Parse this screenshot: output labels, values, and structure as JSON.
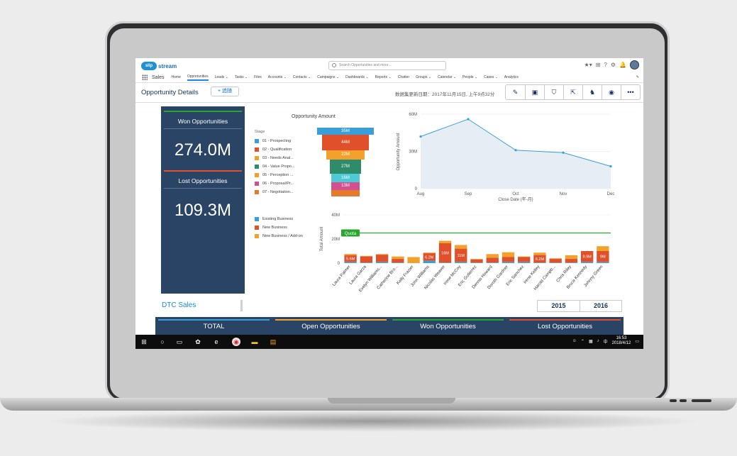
{
  "brand": {
    "logo_text": "stream",
    "logo_prefix": "slip"
  },
  "search": {
    "placeholder": "Search Opportunities and more..."
  },
  "app_name": "Sales",
  "nav": [
    {
      "label": "Home"
    },
    {
      "label": "Opportunities",
      "active": true
    },
    {
      "label": "Leads ⌄"
    },
    {
      "label": "Tasks ⌄"
    },
    {
      "label": "Files"
    },
    {
      "label": "Accounts ⌄"
    },
    {
      "label": "Contacts ⌄"
    },
    {
      "label": "Campaigns ⌄"
    },
    {
      "label": "Dashboards ⌄"
    },
    {
      "label": "Reports ⌄"
    },
    {
      "label": "Chatter"
    },
    {
      "label": "Groups ⌄"
    },
    {
      "label": "Calendar ⌄"
    },
    {
      "label": "People ⌄"
    },
    {
      "label": "Cases ⌄"
    },
    {
      "label": "Analytics"
    }
  ],
  "page": {
    "title": "Opportunity Details",
    "follow_label": "+ 追随",
    "updated": "数据集更新日期：2017年11月15日, 上午9点32分"
  },
  "kpi": {
    "won_label": "Won Opportunities",
    "won_value": "274.0M",
    "lost_label": "Lost Opportunities",
    "lost_value": "109.3M"
  },
  "funnel": {
    "title": "Opportunity Amount",
    "legend_title": "Stage",
    "stages": [
      {
        "label": "01 - Prospecting",
        "color": "#3a9fd8",
        "value": "35M"
      },
      {
        "label": "02 - Qualification",
        "color": "#e0502a",
        "value": "44M"
      },
      {
        "label": "03 - Needs Anal...",
        "color": "#f2a22b",
        "value": "22M"
      },
      {
        "label": "04 - Value Propo...",
        "color": "#2f8c6a",
        "value": "27M"
      },
      {
        "label": "05 - Perception ...",
        "color": "#f2a22b",
        "value": "16M"
      },
      {
        "label": "06 - Proposal/Pr...",
        "color": "#d44f8f",
        "value": "13M"
      },
      {
        "label": "07 - Negotiation...",
        "color": "#e57a2b",
        "value": ""
      }
    ],
    "segments": [
      {
        "value": "35M",
        "color": "#3a9fd8"
      },
      {
        "value": "44M",
        "color": "#e0502a"
      },
      {
        "value": "22M",
        "color": "#f2a22b"
      },
      {
        "value": "27M",
        "color": "#2f8c6a"
      },
      {
        "value": "16M",
        "color": "#4ec9d6"
      },
      {
        "value": "13M",
        "color": "#d44f8f"
      },
      {
        "value": "",
        "color": "#e57a2b"
      }
    ]
  },
  "chart_data": [
    {
      "type": "area",
      "x": [
        "Aug",
        "Sep",
        "Oct",
        "Nov",
        "Dec"
      ],
      "values": [
        42,
        56,
        31,
        29,
        18
      ],
      "xlabel": "Close Date (年-月)",
      "ylabel": "Opportunity Amount",
      "yticks": [
        "60M",
        "30M",
        "0"
      ],
      "ylim": [
        0,
        60
      ],
      "color": "#3a9fd8"
    },
    {
      "type": "bar",
      "categories": [
        "Laura Palmer",
        "Laura Garza",
        "Evelyn Williams...",
        "Catherine Bro...",
        "Kelly Frazier",
        "John Williams",
        "Nicolas Weaver",
        "Irene McCoy",
        "Eric Gutierrez",
        "Dennis Howard",
        "Doroth Gardner",
        "Eric Sanchez",
        "Irene Kelley",
        "Harold Campb...",
        "Chris Riley",
        "Bruce Kennedy",
        "Johnny Green"
      ],
      "series": [
        {
          "name": "Existing Business",
          "color": "#3a9fd8",
          "values": [
            1,
            0.5,
            1,
            0.5,
            0,
            2,
            0.5,
            1,
            0.5,
            0.5,
            1,
            1,
            0.5,
            0.5,
            0.5,
            1,
            1
          ]
        },
        {
          "name": "New Business",
          "color": "#e0502a",
          "values": [
            5.6,
            5,
            6,
            3,
            0,
            6.2,
            16,
            11,
            2.5,
            4,
            4,
            4,
            6.2,
            3,
            3,
            9,
            9
          ]
        },
        {
          "name": "New Business / Add-on",
          "color": "#f2a22b",
          "values": [
            1,
            0.5,
            0.5,
            2,
            5,
            0.5,
            2,
            3,
            0.5,
            3,
            4,
            0.5,
            2,
            0.5,
            3,
            0,
            4
          ]
        }
      ],
      "data_labels": [
        "5.6M",
        "",
        "",
        "",
        "",
        "6.2M",
        "16M",
        "11M",
        "",
        "",
        "",
        "",
        "6.2M",
        "",
        "",
        "9.9M",
        "9M"
      ],
      "ylabel": "Total Amount",
      "yticks": [
        "40M",
        "20M",
        "0"
      ],
      "ylim": [
        0,
        40
      ],
      "quota_label": "Quota",
      "quota_value": 25,
      "quota_color": "#2aa52f"
    }
  ],
  "bar_legend": [
    {
      "label": "Existing Business",
      "color": "#3a9fd8"
    },
    {
      "label": "New Business",
      "color": "#e0502a"
    },
    {
      "label": "New Business / Add-on",
      "color": "#f2a22b"
    }
  ],
  "section": {
    "title": "DTC Sales"
  },
  "years": [
    "2015",
    "2016"
  ],
  "summary": [
    {
      "label": "TOTAL",
      "color": "#3a9fd8"
    },
    {
      "label": "Open Opportunities",
      "color": "#f2a22b"
    },
    {
      "label": "Won Opportunities",
      "color": "#2aa52f"
    },
    {
      "label": "Lost Opportunities",
      "color": "#e0502a"
    }
  ],
  "taskbar": {
    "time": "16:53",
    "date": "2018/4/12",
    "ime": "中",
    "icons": [
      "windows-icon",
      "search-icon",
      "task-view-icon",
      "widgets-icon",
      "edge-icon",
      "chrome-icon",
      "explorer-icon",
      "app-icon"
    ]
  }
}
